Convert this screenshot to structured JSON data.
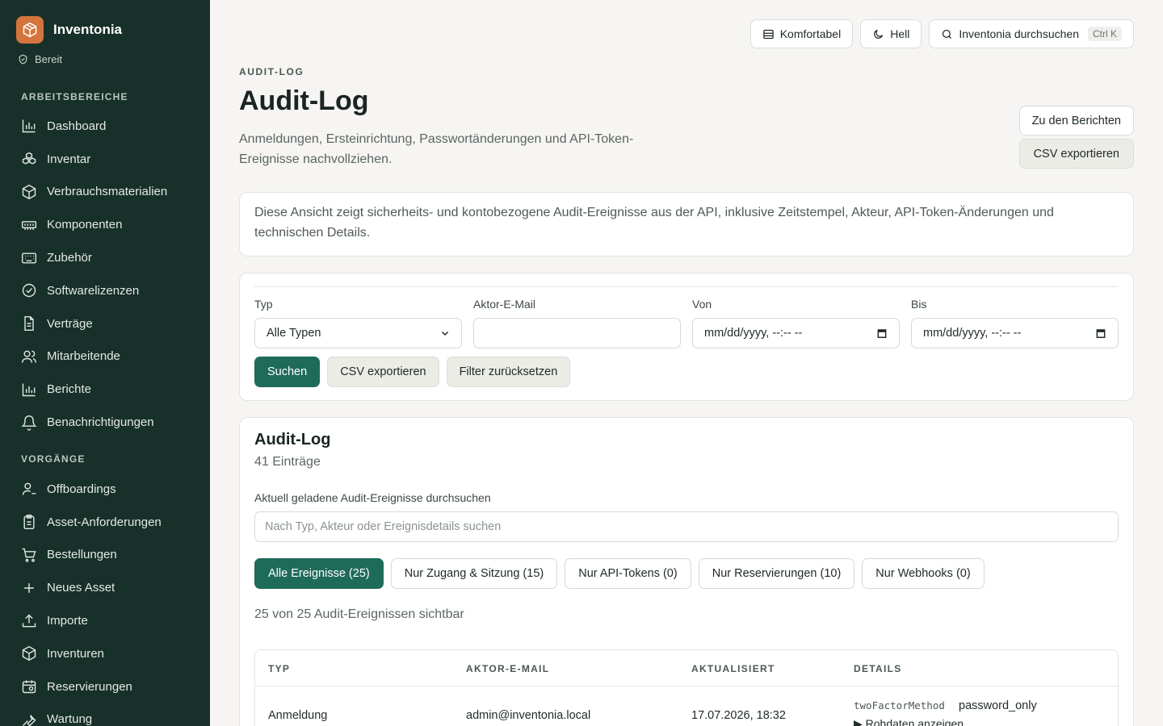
{
  "app": {
    "name": "Inventonia",
    "status": "Bereit"
  },
  "sidebar": {
    "section1": "ARBEITSBEREICHE",
    "items1": [
      {
        "label": "Dashboard",
        "icon": "bar-chart-icon"
      },
      {
        "label": "Inventar",
        "icon": "boxes-icon"
      },
      {
        "label": "Verbrauchsmaterialien",
        "icon": "package-icon"
      },
      {
        "label": "Komponenten",
        "icon": "memory-icon"
      },
      {
        "label": "Zubehör",
        "icon": "keyboard-icon"
      },
      {
        "label": "Softwarelizenzen",
        "icon": "check-circle-icon"
      },
      {
        "label": "Verträge",
        "icon": "document-icon"
      },
      {
        "label": "Mitarbeitende",
        "icon": "users-icon"
      },
      {
        "label": "Berichte",
        "icon": "bar-chart-icon"
      },
      {
        "label": "Benachrichtigungen",
        "icon": "bell-icon"
      }
    ],
    "section2": "VORGÄNGE",
    "items2": [
      {
        "label": "Offboardings",
        "icon": "user-minus-icon"
      },
      {
        "label": "Asset-Anforderungen",
        "icon": "clipboard-icon"
      },
      {
        "label": "Bestellungen",
        "icon": "cart-icon"
      },
      {
        "label": "Neues Asset",
        "icon": "plus-icon"
      },
      {
        "label": "Importe",
        "icon": "upload-icon"
      },
      {
        "label": "Inventuren",
        "icon": "package-icon"
      },
      {
        "label": "Reservierungen",
        "icon": "calendar-icon"
      },
      {
        "label": "Wartung",
        "icon": "wrench-icon"
      }
    ]
  },
  "topbar": {
    "density": "Komfortabel",
    "theme": "Hell",
    "search": "Inventonia durchsuchen",
    "shortcut": "Ctrl K"
  },
  "header": {
    "eyebrow": "AUDIT-LOG",
    "title": "Audit-Log",
    "description": "Anmeldungen, Ersteinrichtung, Passwortänderungen und API-Token-Ereignisse nachvollziehen.",
    "to_reports": "Zu den Berichten",
    "export_csv": "CSV exportieren"
  },
  "info": "Diese Ansicht zeigt sicherheits- und kontobezogene Audit-Ereignisse aus der API, inklusive Zeitstempel, Akteur, API-Token-Änderungen und technischen Details.",
  "filters": {
    "type_label": "Typ",
    "type_value": "Alle Typen",
    "actor_label": "Aktor-E-Mail",
    "actor_value": "",
    "from_label": "Von",
    "from_placeholder": "mm/dd/yyyy, --:-- --",
    "to_label": "Bis",
    "to_placeholder": "mm/dd/yyyy, --:-- --",
    "search_btn": "Suchen",
    "csv_btn": "CSV exportieren",
    "reset_btn": "Filter zurücksetzen"
  },
  "log": {
    "title": "Audit-Log",
    "count": "41 Einträge",
    "search_label": "Aktuell geladene Audit-Ereignisse durchsuchen",
    "search_placeholder": "Nach Typ, Akteur oder Ereignisdetails suchen",
    "chips": [
      {
        "label": "Alle Ereignisse (25)",
        "active": true
      },
      {
        "label": "Nur Zugang & Sitzung (15)",
        "active": false
      },
      {
        "label": "Nur API-Tokens (0)",
        "active": false
      },
      {
        "label": "Nur Reservierungen (10)",
        "active": false
      },
      {
        "label": "Nur Webhooks (0)",
        "active": false
      }
    ],
    "visible_text": "25 von 25 Audit-Ereignissen sichtbar",
    "columns": [
      "TYP",
      "AKTOR-E-MAIL",
      "AKTUALISIERT",
      "DETAILS"
    ],
    "rows": [
      {
        "type": "Anmeldung",
        "actor": "admin@inventonia.local",
        "updated": "17.07.2026, 18:32",
        "detail_key": "twoFactorMethod",
        "detail_value": "password_only",
        "raw_toggle": "▶ Rohdaten anzeigen"
      }
    ]
  },
  "colors": {
    "sidebar": "#18302a",
    "accent": "#1f6b5a",
    "brand": "#d4753d"
  }
}
